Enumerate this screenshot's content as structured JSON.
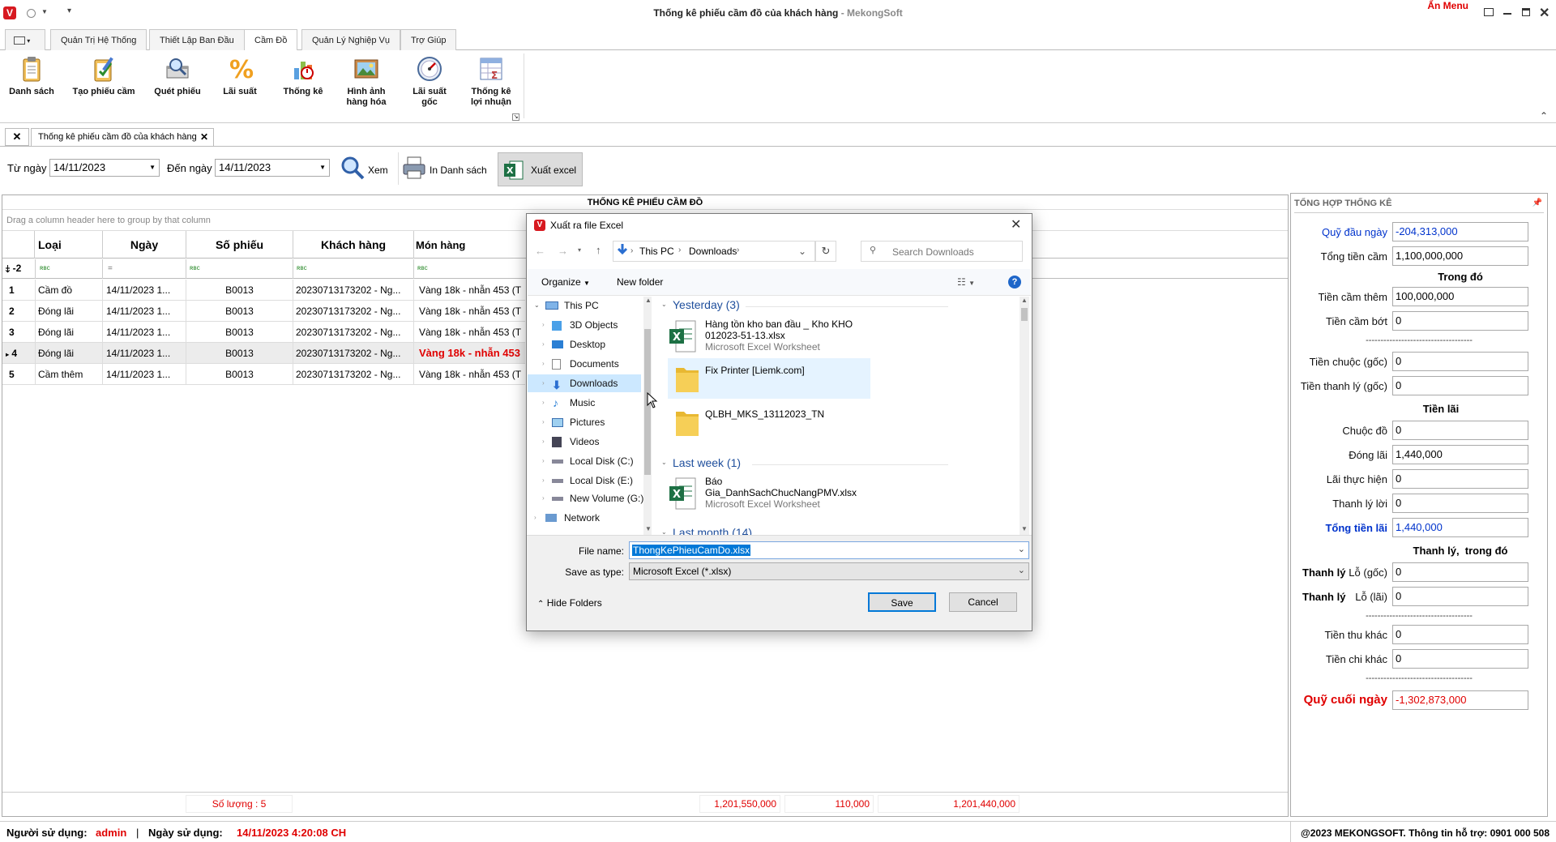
{
  "window": {
    "title": "Thống kê phiếu cầm đồ của khách hàng",
    "brand": " - MekongSoft",
    "an_menu": "Ẩn Menu"
  },
  "ribbon_tabs": [
    "Quản Trị Hệ Thống",
    "Thiết Lập Ban Đầu",
    "Cầm Đồ",
    "Quản Lý Nghiệp Vụ",
    "Trợ Giúp"
  ],
  "ribbon": {
    "danh_sach": "Danh sách",
    "tao_phieu": "Tạo phiếu cầm",
    "quet_phieu": "Quét phiếu",
    "lai_suat": "Lãi suất",
    "thong_ke": "Thống kê",
    "hinh_anh_1": "Hình ảnh",
    "hinh_anh_2": "hàng hóa",
    "lai_goc_1": "Lãi suất",
    "lai_goc_2": "gốc",
    "tk_loi_1": "Thống kê",
    "tk_loi_2": "lợi nhuận"
  },
  "doc_tab": "Thống kê phiếu cầm đồ của khách hàng",
  "filter": {
    "from_label": "Từ ngày",
    "from_value": "14/11/2023",
    "to_label": "Đến ngày",
    "to_value": "14/11/2023",
    "view": "Xem",
    "print": "In Danh sách",
    "export": "Xuất excel"
  },
  "grid": {
    "title": "THỐNG KÊ PHIẾU CẦM ĐỒ",
    "group_hint": "Drag a column header here to group by that column",
    "columns": [
      "Loại",
      "Ngày",
      "Số phiếu",
      "Khách hàng",
      "Món hàng"
    ],
    "filter_row_index": "-2",
    "rows": [
      {
        "no": "1",
        "loai": "Cầm đồ",
        "ngay": "14/11/2023 1...",
        "so": "B0013",
        "kh": "20230713173202 - Ng...",
        "mon": "Vàng 18k - nhẫn 453 (T"
      },
      {
        "no": "2",
        "loai": "Đóng lãi",
        "ngay": "14/11/2023 1...",
        "so": "B0013",
        "kh": "20230713173202 - Ng...",
        "mon": "Vàng 18k - nhẫn 453 (T"
      },
      {
        "no": "3",
        "loai": "Đóng lãi",
        "ngay": "14/11/2023 1...",
        "so": "B0013",
        "kh": "20230713173202 - Ng...",
        "mon": "Vàng 18k - nhẫn 453 (T"
      },
      {
        "no": "4",
        "loai": "Đóng lãi",
        "ngay": "14/11/2023 1...",
        "so": "B0013",
        "kh": "20230713173202 - Ng...",
        "mon": "Vàng 18k - nhẫn 453"
      },
      {
        "no": "5",
        "loai": "Cầm thêm",
        "ngay": "14/11/2023 1...",
        "so": "B0013",
        "kh": "20230713173202 - Ng...",
        "mon": "Vàng 18k - nhẫn 453 (T"
      }
    ],
    "footer": {
      "count": "Số lượng : 5",
      "sum1": "1,201,550,000",
      "sum2": "110,000",
      "sum3": "1,201,440,000"
    }
  },
  "summary": {
    "header": "TỔNG HỢP THỐNG KÊ",
    "quy_dau_ngay": {
      "label": "Quỹ đầu ngày",
      "value": "-204,313,000"
    },
    "tong_tien_cam": {
      "label": "Tổng tiền cầm",
      "value": "1,100,000,000"
    },
    "trong_do": "Trong đó",
    "tien_cam_them": {
      "label": "Tiền cầm thêm",
      "value": "100,000,000"
    },
    "tien_cam_bot": {
      "label": "Tiền cầm bớt",
      "value": "0"
    },
    "divider": "------------------------------------",
    "tien_chuoc_goc": {
      "label": "Tiền chuộc (gốc)",
      "value": "0"
    },
    "tien_thanh_ly_goc": {
      "label": "Tiền thanh lý (gốc)",
      "value": "0"
    },
    "tien_lai": "Tiền lãi",
    "chuoc_do": {
      "label": "Chuộc đồ",
      "value": "0"
    },
    "dong_lai": {
      "label": "Đóng lãi",
      "value": "1,440,000"
    },
    "lai_thuc_hien": {
      "label": "Lãi thực hiện",
      "value": "0"
    },
    "thanh_ly_loi": {
      "label": "Thanh lý lời",
      "value": "0"
    },
    "tong_tien_lai": {
      "label": "Tổng tiền lãi",
      "value": "1,440,000"
    },
    "thanh_ly_trong_do": "Thanh lý,  trong đó",
    "thanh_ly_word": "Thanh lý",
    "lo_goc": {
      "label": "Lỗ (gốc)",
      "value": "0"
    },
    "lo_lai": {
      "label": "Lỗ (lãi)",
      "value": "0"
    },
    "tien_thu_khac": {
      "label": "Tiền thu khác",
      "value": "0"
    },
    "tien_chi_khac": {
      "label": "Tiền chi khác",
      "value": "0"
    },
    "quy_cuoi_ngay": {
      "label": "Quỹ cuối ngày",
      "value": "-1,302,873,000"
    }
  },
  "dialog": {
    "title": "Xuất ra file Excel",
    "breadcrumb": [
      "This PC",
      "Downloads"
    ],
    "search_placeholder": "Search Downloads",
    "organize": "Organize",
    "new_folder": "New folder",
    "tree": [
      "This PC",
      "3D Objects",
      "Desktop",
      "Documents",
      "Downloads",
      "Music",
      "Pictures",
      "Videos",
      "Local Disk (C:)",
      "Local Disk (E:)",
      "New Volume (G:)",
      "Network"
    ],
    "groups": {
      "yesterday": "Yesterday (3)",
      "last_week": "Last week (1)",
      "last_month": "Last month (14)"
    },
    "files": [
      {
        "name1": "Hàng tồn kho ban đầu _ Kho KHO",
        "name2": "012023-51-13.xlsx",
        "type": "Microsoft Excel Worksheet"
      },
      {
        "name1": "Fix Printer [Liemk.com]"
      },
      {
        "name1": "QLBH_MKS_13112023_TN"
      },
      {
        "name1": "Báo",
        "name2": "Gia_DanhSachChucNangPMV.xlsx",
        "type": "Microsoft Excel Worksheet"
      }
    ],
    "file_name_label": "File name:",
    "file_name": "ThongKePhieuCamDo.xlsx",
    "save_type_label": "Save as type:",
    "save_type": "Microsoft Excel (*.xlsx)",
    "hide_folders": "Hide Folders",
    "save": "Save",
    "cancel": "Cancel"
  },
  "status": {
    "user_label": "Người sử dụng:",
    "user": "admin",
    "sep": "|",
    "date_label": "Ngày sử dụng:",
    "date": "14/11/2023 4:20:08 CH",
    "copyright": "@2023 MEKONGSOFT. Thông tin hỗ trợ: 0901 000 508"
  },
  "colors": {
    "accent_red": "#e00000",
    "link_blue": "#0033cc",
    "selection": "#cce8ff",
    "excel_green": "#1d7044"
  }
}
